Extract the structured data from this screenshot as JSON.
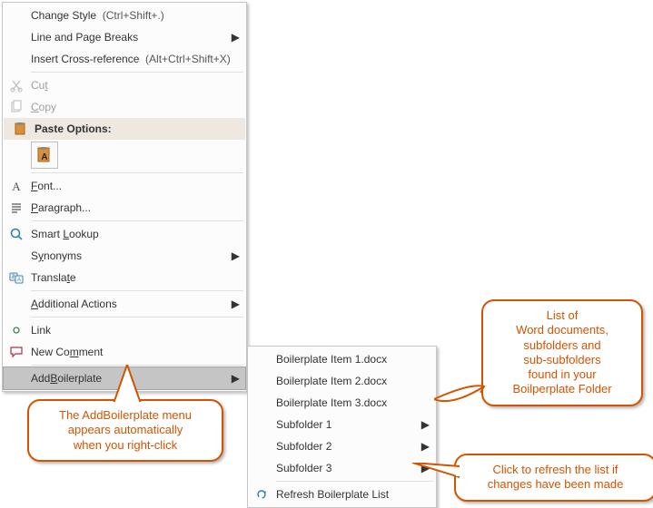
{
  "main_menu": {
    "change_style": {
      "label": "Change Style",
      "shortcut": "(Ctrl+Shift+.)"
    },
    "line_page_breaks": "Line and Page Breaks",
    "cross_ref": {
      "label": "Insert Cross-reference",
      "shortcut": "(Alt+Ctrl+Shift+X)"
    },
    "cut": "Cut",
    "copy": "Copy",
    "paste_options": "Paste Options:",
    "font": "Font...",
    "paragraph": "Paragraph...",
    "smart_lookup": "Smart Lookup",
    "synonyms": "Synonyms",
    "translate": "Translate",
    "additional_actions": "Additional Actions",
    "link": "Link",
    "new_comment": "New Comment",
    "add_boilerplate": "AddBoilerplate"
  },
  "submenu": {
    "item1": "Boilerplate Item 1.docx",
    "item2": "Boilerplate Item 2.docx",
    "item3": "Boilerplate Item 3.docx",
    "sub1": "Subfolder 1",
    "sub2": "Subfolder 2",
    "sub3": "Subfolder 3",
    "refresh": "Refresh Boilerplate List"
  },
  "callouts": {
    "left": "The AddBoilerplate menu\nappears automatically\nwhen you right-click",
    "right_top": "List of\nWord documents,\nsubfolders and\nsub-subfolders\nfound in your\nBoilperplate Folder",
    "right_bottom": "Click to refresh the list if\nchanges have been made"
  }
}
